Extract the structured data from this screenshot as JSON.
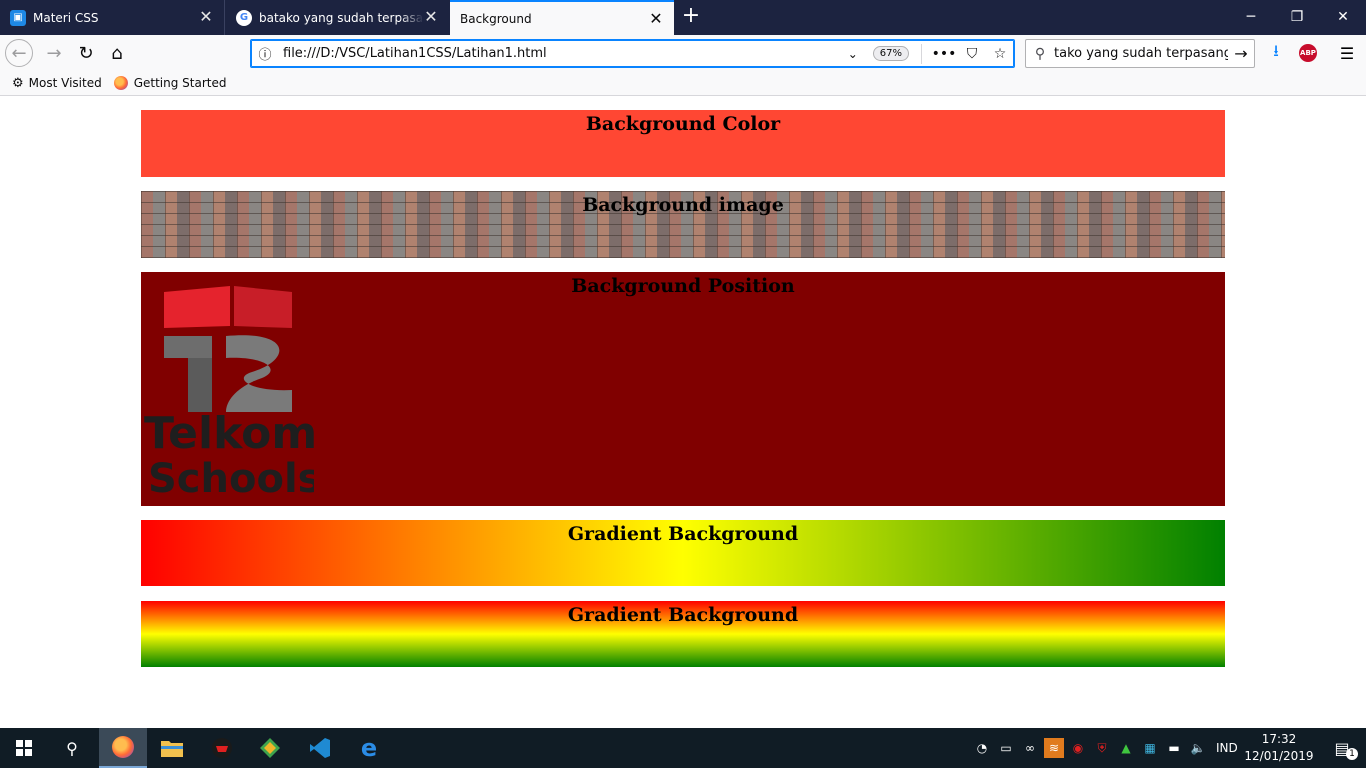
{
  "browser": {
    "tabs": [
      {
        "title": "Materi CSS",
        "icon": "google-classroom-icon"
      },
      {
        "title": "batako yang sudah terpasang - Google Search",
        "icon": "google-icon"
      },
      {
        "title": "Background",
        "icon": "none",
        "active": true
      }
    ],
    "new_tab_label": "+",
    "window_controls": {
      "minimize": "─",
      "restore": "❐",
      "close": "✕"
    },
    "nav": {
      "back": "←",
      "forward": "→",
      "reload": "↻",
      "home": "⌂"
    },
    "url": "file:///D:/VSC/Latihan1CSS/Latihan1.html",
    "zoom": "67%",
    "search_value": "tako yang sudah terpasang",
    "bookmarks": [
      {
        "label": "Most Visited",
        "icon": "gear-icon"
      },
      {
        "label": "Getting Started",
        "icon": "firefox-icon"
      }
    ]
  },
  "page": {
    "sections": [
      {
        "heading": "Background Color",
        "color": "#ff4733"
      },
      {
        "heading": "Background image"
      },
      {
        "heading": "Background Position",
        "color": "#800000"
      },
      {
        "heading": "Gradient Background",
        "colors": [
          "#ff0000",
          "#ffff00",
          "#008000"
        ],
        "direction": "horizontal"
      },
      {
        "heading": "Gradient Background",
        "colors": [
          "#ff0000",
          "#ffff00",
          "#008000"
        ],
        "direction": "vertical"
      }
    ],
    "logo": {
      "line1": "Telkom",
      "line2": "Schools"
    }
  },
  "taskbar": {
    "language": "IND",
    "time": "17:32",
    "date": "12/01/2019",
    "notification_count": "1"
  }
}
